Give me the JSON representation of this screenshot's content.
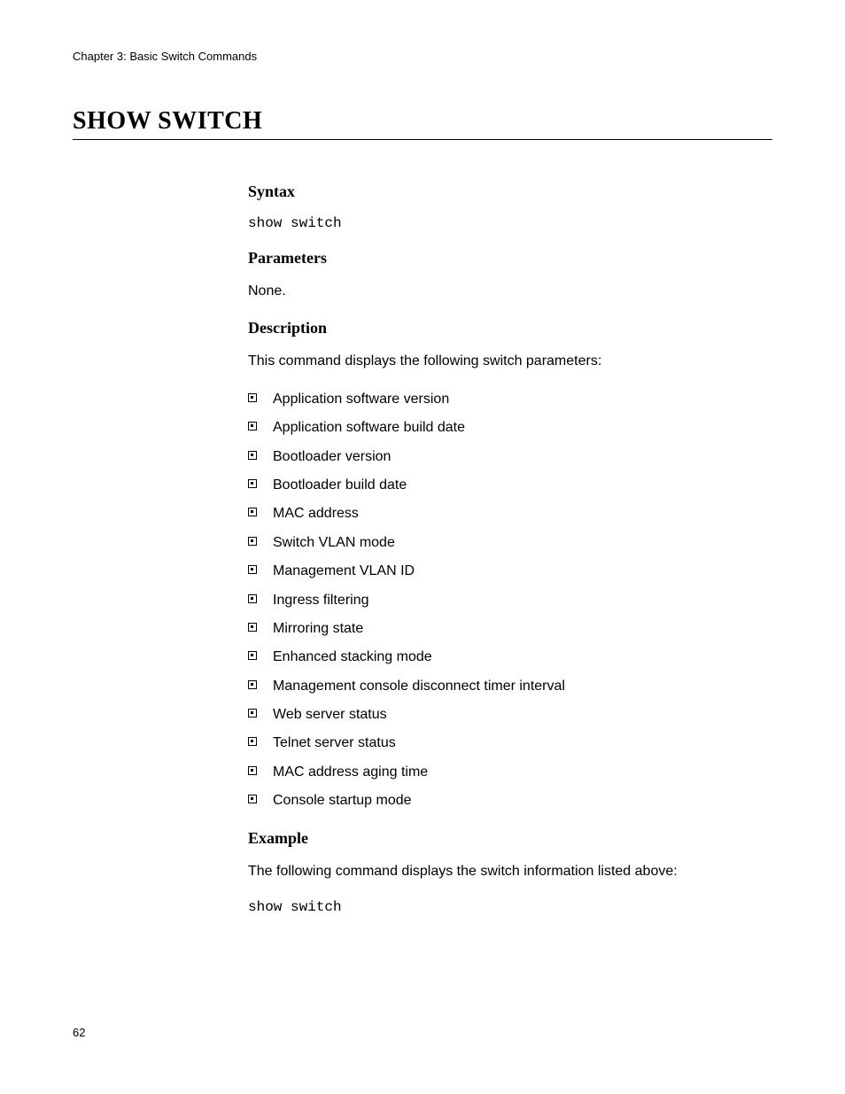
{
  "chapter_header": "Chapter 3: Basic Switch Commands",
  "page_title": "Show Switch",
  "sections": {
    "syntax": {
      "heading": "Syntax",
      "code": "show switch"
    },
    "parameters": {
      "heading": "Parameters",
      "text": "None."
    },
    "description": {
      "heading": "Description",
      "intro": "This command displays the following switch parameters:",
      "items": [
        "Application software version",
        "Application software build date",
        "Bootloader version",
        "Bootloader build date",
        "MAC address",
        "Switch VLAN mode",
        "Management VLAN ID",
        "Ingress filtering",
        "Mirroring state",
        "Enhanced stacking mode",
        "Management console disconnect timer interval",
        "Web server status",
        "Telnet server status",
        "MAC address aging time",
        "Console startup mode"
      ]
    },
    "example": {
      "heading": "Example",
      "text": "The following command displays the switch information listed above:",
      "code": "show switch"
    }
  },
  "page_number": "62"
}
